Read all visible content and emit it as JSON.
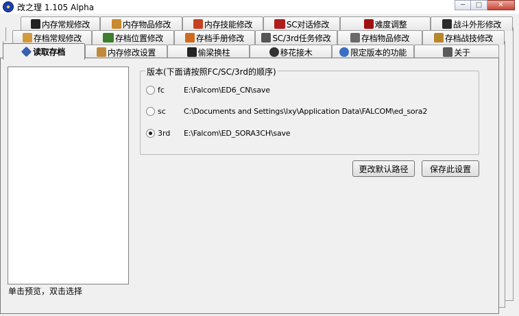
{
  "window": {
    "title": "改之理 1.105 Alpha",
    "min_glyph": "─",
    "max_glyph": "□",
    "close_glyph": "✕"
  },
  "tabs_row1": [
    {
      "label": "内存常规修改",
      "icon": "memory-icon",
      "color": "#222222"
    },
    {
      "label": "内存物品修改",
      "icon": "potion-icon",
      "color": "#c9892e"
    },
    {
      "label": "内存技能修改",
      "icon": "skill-icon",
      "color": "#c7401f"
    },
    {
      "label": "SC对话修改",
      "icon": "talk-icon",
      "color": "#b11d1d"
    },
    {
      "label": "难度调整",
      "icon": "difficulty-icon",
      "color": "#a01010"
    },
    {
      "label": "战斗外形修改",
      "icon": "battle-icon",
      "color": "#2b2b2b"
    }
  ],
  "tabs_row2": [
    {
      "label": "存档常规修改",
      "icon": "save-icon",
      "color": "#d29a3a"
    },
    {
      "label": "存档位置修改",
      "icon": "location-icon",
      "color": "#3d7d2e"
    },
    {
      "label": "存档手册修改",
      "icon": "book-icon",
      "color": "#d16a1e"
    },
    {
      "label": "SC/3rd任务修改",
      "icon": "quest-icon",
      "color": "#555555"
    },
    {
      "label": "存档物品修改",
      "icon": "sword-icon",
      "color": "#6a6a6a"
    },
    {
      "label": "存档战技修改",
      "icon": "craft-icon",
      "color": "#b8862a"
    }
  ],
  "tabs_row3": [
    {
      "label": "读取存档",
      "icon": "load-icon",
      "color": "#3a5fb0"
    },
    {
      "label": "内存修改设置",
      "icon": "settings-icon",
      "color": "#c08a3a"
    },
    {
      "label": "偷梁换柱",
      "icon": "swap-icon",
      "color": "#222222"
    },
    {
      "label": "移花接木",
      "icon": "graft-icon",
      "color": "#333333"
    },
    {
      "label": "限定版本的功能",
      "icon": "limited-icon",
      "color": "#3c6fc2"
    },
    {
      "label": "关于",
      "icon": "about-icon",
      "color": "#5a5a5a"
    }
  ],
  "panel": {
    "hint": "单击预览，双击选择",
    "group_title": "版本(下面请按照FC/SC/3rd的顺序)",
    "versions": [
      {
        "label": "fc",
        "path": "E:\\Falcom\\ED6_CN\\save",
        "checked": false
      },
      {
        "label": "sc",
        "path": "C:\\Documents and Settings\\lxy\\Application Data\\FALCOM\\ed_sora2",
        "checked": false
      },
      {
        "label": "3rd",
        "path": "E:\\Falcom\\ED_SORA3CH\\save",
        "checked": true
      }
    ],
    "change_default_path": "更改默认路径",
    "save_settings": "保存此设置"
  }
}
